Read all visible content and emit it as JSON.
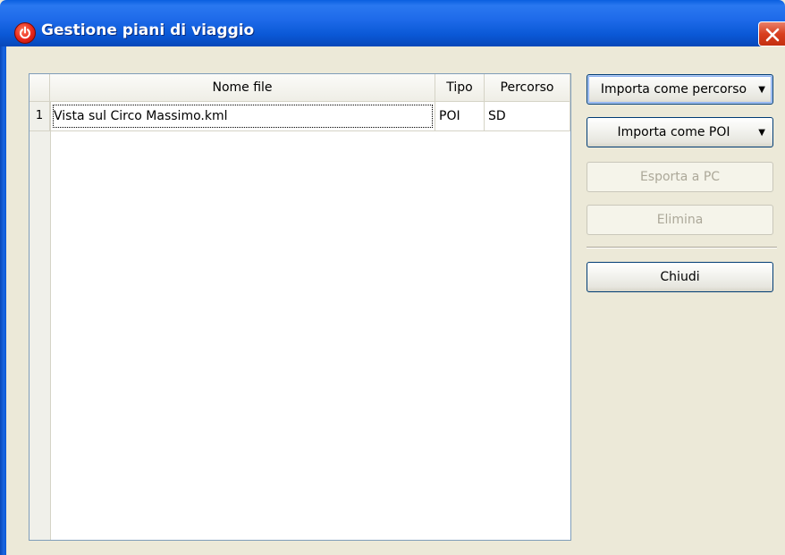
{
  "window": {
    "title": "Gestione piani di viaggio"
  },
  "table": {
    "columns": [
      "Nome file",
      "Tipo",
      "Percorso"
    ],
    "rows": [
      {
        "num": "1",
        "nome_file": "Vista sul Circo Massimo.kml",
        "tipo": "POI",
        "percorso": "SD"
      }
    ]
  },
  "buttons": {
    "import_route": "Importa come percorso",
    "import_poi": "Importa come POI",
    "export_pc": "Esporta a PC",
    "delete": "Elimina",
    "close": "Chiudi"
  },
  "colors": {
    "titlebar": "#0a58d6",
    "window_bg": "#ece9d8",
    "close_button": "#d9401f"
  },
  "icons": {
    "app": "power-icon",
    "close": "close-icon",
    "dropdown": "caret-down-icon"
  }
}
